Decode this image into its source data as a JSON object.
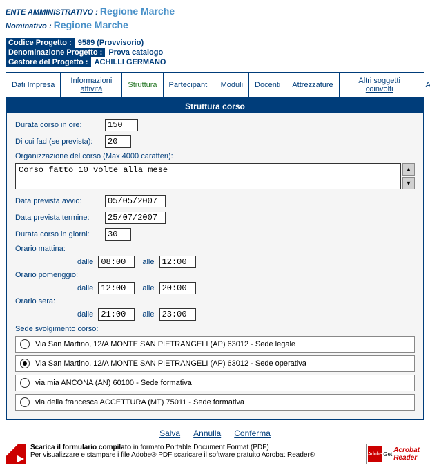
{
  "header": {
    "ente_label": "ENTE AMMINISTRATIVO :",
    "ente_value": "Regione Marche",
    "nom_label": "Nominativo :",
    "nom_value": "Regione Marche"
  },
  "info": {
    "codice_label": "Codice Progetto :",
    "codice_value": "9589 (Provvisorio)",
    "denom_label": "Denominazione Progetto :",
    "denom_value": "Prova catalogo",
    "gestore_label": "Gestore del Progetto :",
    "gestore_value": "ACHILLI GERMANO"
  },
  "tabs": {
    "t0": "Dati Impresa",
    "t1": "Informazioni attività",
    "t2": "Struttura",
    "t3": "Partecipanti",
    "t4": "Moduli",
    "t5": "Docenti",
    "t6": "Attrezzature",
    "t7": "Altri soggetti coinvolti",
    "t8": "Attestati"
  },
  "panel": {
    "title": "Struttura corso",
    "durata_ore_label": "Durata corso in ore:",
    "durata_ore_value": "150",
    "fad_label": "Di cui fad (se prevista):",
    "fad_value": "20",
    "org_label": "Organizzazione del corso (Max 4000 caratteri):",
    "org_value": "Corso fatto 10 volte alla mese",
    "avvio_label": "Data prevista avvio:",
    "avvio_value": "05/05/2007",
    "termine_label": "Data prevista termine:",
    "termine_value": "25/07/2007",
    "giorni_label": "Durata corso in giorni:",
    "giorni_value": "30",
    "mattina_label": "Orario mattina:",
    "pomeriggio_label": "Orario pomeriggio:",
    "sera_label": "Orario sera:",
    "dalle": "dalle",
    "alle": "alle",
    "mattina_dalle": "08:00",
    "mattina_alle": "12:00",
    "pom_dalle": "12:00",
    "pom_alle": "20:00",
    "sera_dalle": "21:00",
    "sera_alle": "23:00",
    "sede_label": "Sede svolgimento corso:",
    "sede0": "Via San Martino, 12/A MONTE SAN PIETRANGELI (AP) 63012 - Sede legale",
    "sede1": "Via San Martino, 12/A MONTE SAN PIETRANGELI (AP) 63012 - Sede operativa",
    "sede2": "via mia ANCONA (AN) 60100 - Sede formativa",
    "sede3": "via della francesca ACCETTURA (MT) 75011 - Sede formativa"
  },
  "actions": {
    "salva": "Salva",
    "annulla": "Annulla",
    "conferma": "Conferma"
  },
  "footer": {
    "line1a": "Scarica il formulario compilato",
    "line1b": " in formato Portable Document Format (PDF)",
    "line2": "Per visualizzare e stampare i file Adobe® PDF scaricare il software gratuito Acrobat Reader®",
    "adobe": "Adobe",
    "get": "Get",
    "acrobat": "Acrobat",
    "reader": "Reader"
  }
}
